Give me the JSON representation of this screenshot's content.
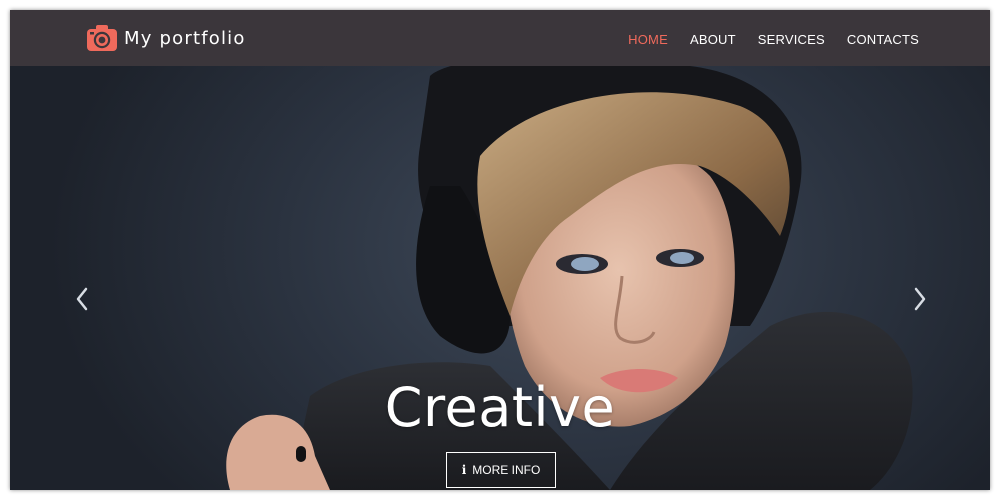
{
  "brand": {
    "name": "My portfolio",
    "icon": "camera-icon",
    "accent_color": "#ef6a5c"
  },
  "nav": {
    "items": [
      {
        "label": "HOME",
        "active": true
      },
      {
        "label": "ABOUT",
        "active": false
      },
      {
        "label": "SERVICES",
        "active": false
      },
      {
        "label": "CONTACTS",
        "active": false
      }
    ],
    "background_color": "#3b363b"
  },
  "hero": {
    "caption": "Creative",
    "button": {
      "label": "MORE INFO",
      "icon": "info-icon"
    },
    "prev_icon": "chevron-left-icon",
    "next_icon": "chevron-right-icon"
  }
}
